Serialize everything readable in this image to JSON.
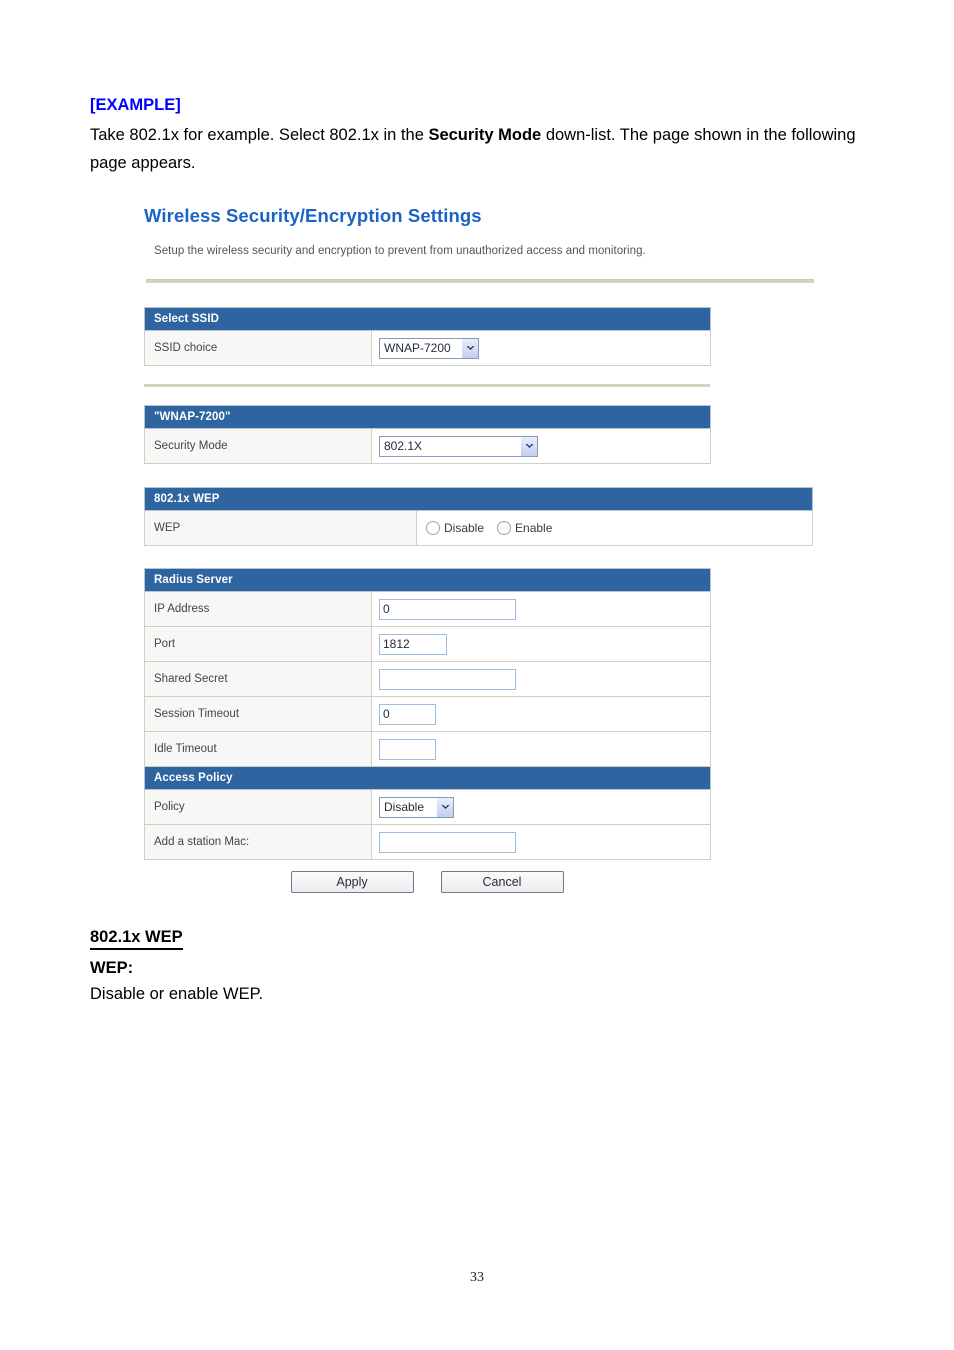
{
  "document": {
    "example_tag": "[EXAMPLE]",
    "intro_before": "Take 802.1x for example. Select 802.1x in the ",
    "intro_bold": "Security Mode",
    "intro_after": " down-list. The page shown in the following page appears.",
    "page_number": "33"
  },
  "screenshot": {
    "title": "Wireless Security/Encryption Settings",
    "description": "Setup the wireless security and encryption to prevent from unauthorized access and monitoring.",
    "accent_color": "#1b63c4",
    "section_header_color": "#2e65a0",
    "sections": {
      "select_ssid": {
        "header": "Select SSID",
        "rows": [
          {
            "label": "SSID choice",
            "value": "WNAP-7200",
            "control": "select"
          }
        ]
      },
      "ssid_profile": {
        "header": "\"WNAP-7200\"",
        "rows": [
          {
            "label": "Security Mode",
            "value": "802.1X",
            "control": "select"
          }
        ]
      },
      "wep_8021x": {
        "header": "802.1x WEP",
        "rows": [
          {
            "label": "WEP",
            "control": "radio",
            "options": [
              {
                "label": "Disable",
                "selected": false
              },
              {
                "label": "Enable",
                "selected": false
              }
            ]
          }
        ]
      },
      "radius_server": {
        "header": "Radius Server",
        "rows": [
          {
            "label": "IP Address",
            "value": "0",
            "control": "text"
          },
          {
            "label": "Port",
            "value": "1812",
            "control": "text"
          },
          {
            "label": "Shared Secret",
            "value": "",
            "control": "text"
          },
          {
            "label": "Session Timeout",
            "value": "0",
            "control": "text"
          },
          {
            "label": "Idle Timeout",
            "value": "",
            "control": "text"
          }
        ]
      },
      "access_policy": {
        "header": "Access Policy",
        "rows": [
          {
            "label": "Policy",
            "value": "Disable",
            "control": "select"
          },
          {
            "label": "Add a station Mac:",
            "value": "",
            "control": "text"
          }
        ]
      }
    },
    "buttons": {
      "apply": "Apply",
      "cancel": "Cancel"
    }
  },
  "trailing": {
    "heading": "802.1x WEP",
    "term": "WEP:",
    "body": "Disable or enable WEP."
  }
}
